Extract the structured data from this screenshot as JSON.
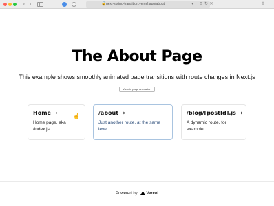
{
  "browser": {
    "url": "next-spring-transition.vercel.app/about",
    "lock_symbol": "🔒",
    "reload_symbol": "↻",
    "back_symbol": "‹",
    "forward_symbol": "›",
    "share_symbol": "⇧",
    "traffic_colors": [
      "#fe5f57",
      "#febc2e",
      "#28c840"
    ]
  },
  "page": {
    "title": "The About Page",
    "subtitle": "This example shows smoothly animated page transitions with route changes in Next.js",
    "toggle_button": "View in page animation"
  },
  "cards": [
    {
      "title": "Home →",
      "description": "Home page, aka /index.js"
    },
    {
      "title": "/about →",
      "description": "Just another route, at the same level"
    },
    {
      "title": "/blog/[postId].js →",
      "description": "A dynamic route, for example"
    }
  ],
  "footer": {
    "powered_by": "Powered by",
    "brand": "Vercel"
  }
}
